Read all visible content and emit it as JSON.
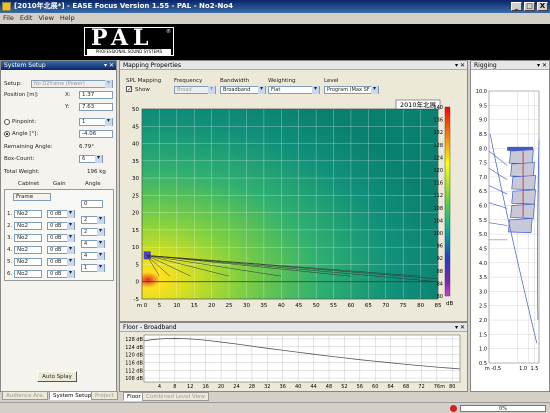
{
  "window": {
    "title": "[2010年北展*] - EASE Focus Version 1.55 - PAL - No2-No4",
    "min": "_",
    "max": "□",
    "close": "X"
  },
  "menu": [
    "File",
    "Edit",
    "View",
    "Help"
  ],
  "logo": {
    "text": "PAL",
    "mark": "®",
    "tagline": "PROFESSIONAL SOUND SYSTEMS"
  },
  "left_panel": {
    "title": "System Setup",
    "header_buttons": "▾ ✕",
    "setup_label": "Setup:",
    "setup_value": "No D2frame (Power)",
    "position_label": "Position [m]:",
    "x_label": "X:",
    "x_value": "1.37",
    "y_label": "Y:",
    "y_value": "7.63",
    "pinpoint_label": "Pinpoint:",
    "pinpoint_value": "1",
    "angle_label": "Angle [°]:",
    "angle_value": "-4.06",
    "remaining_label": "Remaining Angle:",
    "remaining_value": "6.79°",
    "boxcount_label": "Box-Count:",
    "boxcount_value": "6",
    "weight_label": "Total Weight:",
    "weight_value": "196 kg",
    "col_cabinet": "Cabinet",
    "col_gain": "Gain",
    "col_angle": "Angle",
    "frame_label": "Frame",
    "frame_angle": "0",
    "rows": [
      {
        "idx": "1.",
        "cabinet": "No2",
        "gain": "0 dB",
        "angle": "2"
      },
      {
        "idx": "2.",
        "cabinet": "No2",
        "gain": "0 dB",
        "angle": "2"
      },
      {
        "idx": "3.",
        "cabinet": "No2",
        "gain": "0 dB",
        "angle": "4"
      },
      {
        "idx": "4.",
        "cabinet": "No2",
        "gain": "0 dB",
        "angle": "4"
      },
      {
        "idx": "5.",
        "cabinet": "No2",
        "gain": "0 dB",
        "angle": "1"
      },
      {
        "idx": "6.",
        "cabinet": "No2",
        "gain": "0 dB",
        "angle": ""
      }
    ],
    "autosplay": "Auto Splay",
    "tabs": [
      "Audience Are.",
      "System Setup",
      "Project"
    ]
  },
  "mapping": {
    "title": "Mapping Properties",
    "spl_label": "SPL Mapping",
    "show_label": "Show",
    "freq_label": "Frequency",
    "freq_value": "Broad",
    "bw_label": "Bandwidth",
    "bw_value": "Broadband",
    "weight_label": "Weighting",
    "weight_value": "Flat",
    "level_label": "Level",
    "level_value": "Program (Max SF"
  },
  "chart_data": [
    {
      "type": "heatmap",
      "title": "2010年北展",
      "x_ticks": [
        "m 0",
        "5",
        "10",
        "15",
        "20",
        "25",
        "30",
        "35",
        "40",
        "45",
        "50",
        "55",
        "60",
        "65",
        "70",
        "75",
        "80",
        "85"
      ],
      "y_ticks": [
        "50",
        "45",
        "40",
        "35",
        "30",
        "25",
        "20",
        "15",
        "10",
        "5",
        "0",
        "-5"
      ],
      "xlim": [
        0,
        85
      ],
      "ylim": [
        -5,
        50
      ],
      "colorbar_ticks": [
        "140",
        "138",
        "136",
        "134",
        "132",
        "130",
        "128",
        "126",
        "124",
        "122",
        "120",
        "118",
        "116",
        "114",
        "112",
        "110",
        "108",
        "106",
        "104",
        "102",
        "100",
        "98",
        "96",
        "94",
        "92",
        "90",
        "88",
        "86",
        "84",
        "82",
        "80"
      ],
      "colorbar_unit": "dB"
    },
    {
      "type": "line",
      "title": "Floor - Broadband",
      "x_ticks": [
        "4",
        "8",
        "12",
        "16",
        "20",
        "24",
        "28",
        "32",
        "36",
        "40",
        "44",
        "48",
        "52",
        "56",
        "60",
        "64",
        "68",
        "72",
        "76",
        "m",
        "80"
      ],
      "y_ticks": [
        "128 dB",
        "124 dB",
        "120 dB",
        "116 dB",
        "112 dB",
        "108 dB"
      ],
      "xlim": [
        0,
        82
      ],
      "ylim": [
        106,
        130
      ],
      "x": [
        0,
        2,
        4,
        6,
        8,
        10,
        12,
        14,
        16,
        20,
        24,
        28,
        32,
        36,
        40,
        44,
        48,
        52,
        56,
        60,
        64,
        68,
        72,
        76,
        80,
        82
      ],
      "y": [
        127.0,
        127.6,
        128.0,
        128.2,
        128.3,
        128.2,
        128.0,
        127.7,
        127.3,
        126.4,
        125.4,
        124.3,
        123.2,
        122.2,
        121.2,
        120.2,
        119.2,
        118.3,
        117.4,
        116.6,
        115.8,
        115.0,
        114.3,
        113.6,
        113.0,
        112.7
      ]
    },
    {
      "type": "line",
      "title": "Rigging",
      "y_ticks": [
        "10.0",
        "9.5",
        "9.0",
        "8.5",
        "8.0",
        "7.5",
        "7.0",
        "6.5",
        "6.0",
        "5.5",
        "5.0",
        "4.5",
        "4.0",
        "3.5",
        "3.0",
        "2.5",
        "2.0",
        "1.5",
        "1.0",
        "0.5"
      ],
      "x_ticks": [
        "m -0.5",
        "1.0",
        "1.5"
      ]
    }
  ],
  "floor": {
    "title": "Floor - Broadband",
    "tabs": [
      "Floor",
      "Combined Level View"
    ]
  },
  "rigging": {
    "title": "Rigging"
  },
  "status": {
    "progress": "0%"
  },
  "colors": {
    "title_bar": "#0a246a",
    "accent": "#3a6ea5"
  }
}
